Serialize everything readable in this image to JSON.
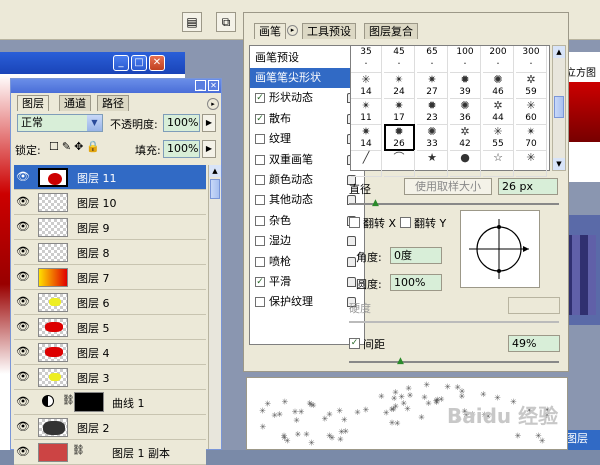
{
  "toolbar": {
    "btn1_icon": "document-icon",
    "btn2_icon": "file-browser-icon"
  },
  "doc_window": {
    "right_label": "立方图"
  },
  "layers": {
    "tabs": [
      "图层",
      "通道",
      "路径"
    ],
    "blend_mode": "正常",
    "opacity_label": "不透明度:",
    "opacity_value": "100%",
    "lock_label": "锁定:",
    "fill_label": "填充:",
    "fill_value": "100%",
    "rows": [
      {
        "name": "图层 11"
      },
      {
        "name": "图层 10"
      },
      {
        "name": "图层 9"
      },
      {
        "name": "图层 8"
      },
      {
        "name": "图层 7"
      },
      {
        "name": "图层 6"
      },
      {
        "name": "图层 5"
      },
      {
        "name": "图层 4"
      },
      {
        "name": "图层 3"
      },
      {
        "name": "曲线 1"
      },
      {
        "name": "图层 2"
      },
      {
        "name": "图层 1 副本"
      }
    ]
  },
  "brushes": {
    "tabs": [
      "画笔",
      "工具预设",
      "图层复合"
    ],
    "presets_label": "画笔预设",
    "options": [
      {
        "label": "画笔笔尖形状",
        "checked": false
      },
      {
        "label": "形状动态",
        "checked": true
      },
      {
        "label": "散布",
        "checked": true
      },
      {
        "label": "纹理",
        "checked": false
      },
      {
        "label": "双重画笔",
        "checked": false
      },
      {
        "label": "颜色动态",
        "checked": false
      },
      {
        "label": "其他动态",
        "checked": false
      },
      {
        "label": "杂色",
        "checked": false
      },
      {
        "label": "湿边",
        "checked": false
      },
      {
        "label": "喷枪",
        "checked": false
      },
      {
        "label": "平滑",
        "checked": true
      },
      {
        "label": "保护纹理",
        "checked": false
      }
    ],
    "grid": [
      [
        "35",
        "45",
        "65",
        "100",
        "200",
        "300"
      ],
      [
        "14",
        "24",
        "27",
        "39",
        "46",
        "59"
      ],
      [
        "11",
        "17",
        "23",
        "36",
        "44",
        "60"
      ],
      [
        "14",
        "26",
        "33",
        "42",
        "55",
        "70"
      ],
      [
        "",
        "",
        "",
        "",
        "",
        ""
      ]
    ],
    "diameter_label": "直径",
    "use_sample_label": "使用取样大小",
    "diameter_value": "26 px",
    "flip_x_label": "翻转 X",
    "flip_y_label": "翻转 Y",
    "angle_label": "角度:",
    "angle_value": "0度",
    "roundness_label": "圆度:",
    "roundness_value": "100%",
    "hardness_label": "硬度",
    "spacing_label": "间距",
    "spacing_value": "49%"
  },
  "bottom_right": {
    "label": "图层"
  },
  "watermark": "Baidu 经验"
}
